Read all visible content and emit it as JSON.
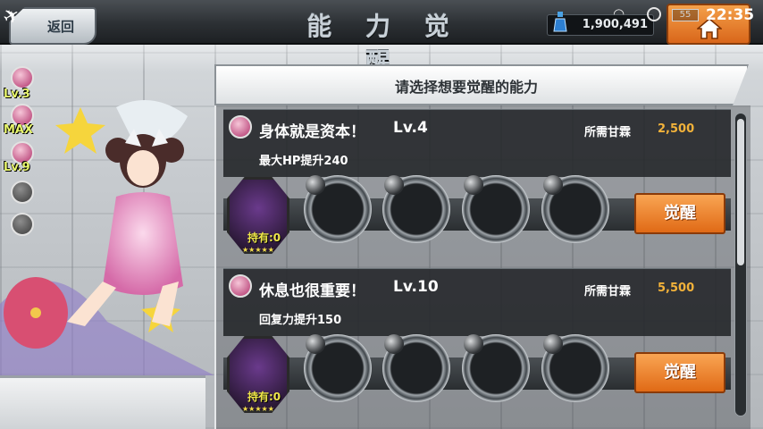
{
  "header": {
    "back_label": "返回",
    "title": "能 力 觉 醒",
    "currency_value": "1,900,491",
    "home_icon": "home-icon"
  },
  "status_bar": {
    "battery": "55",
    "time": "22:35"
  },
  "side_badges": [
    {
      "label": "Lv.3",
      "icon": "hp-icon"
    },
    {
      "label": "MAX",
      "icon": "sword-icon"
    },
    {
      "label": "Lv.9",
      "icon": "heal-icon"
    },
    {
      "label": "",
      "icon": "locked-skill-icon"
    },
    {
      "label": "",
      "icon": "locked-skill-icon"
    }
  ],
  "panel": {
    "instruction": "请选择想要觉醒的能力",
    "abilities": [
      {
        "name": "身体就是资本！",
        "level": "Lv.4",
        "cost_label": "所需甘霖",
        "cost_value": "2,500",
        "description": "最大HP提升240",
        "owned_label": "持有:0",
        "stars": "★★★★★",
        "button": "觉醒",
        "icon": "hp-icon"
      },
      {
        "name": "休息也很重要！",
        "level": "Lv.10",
        "cost_label": "所需甘霖",
        "cost_value": "5,500",
        "description": "回复力提升150",
        "owned_label": "持有:0",
        "stars": "★★★★★",
        "button": "觉醒",
        "icon": "heal-icon"
      }
    ]
  },
  "colors": {
    "accent_orange": "#e06a16",
    "cost_gold": "#f2b23a",
    "topbar": "#2c3034"
  }
}
